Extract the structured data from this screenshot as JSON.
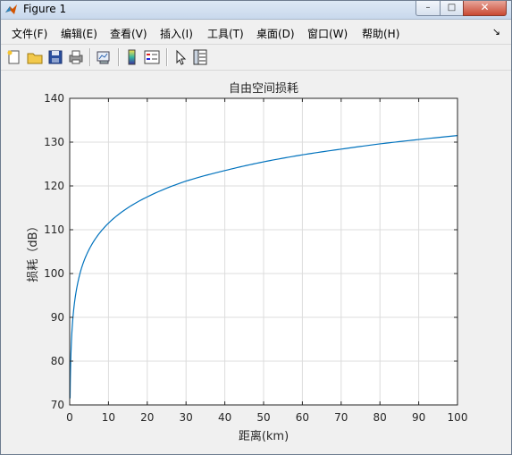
{
  "window": {
    "title": "Figure 1",
    "controls": {
      "minimize": "–",
      "maximize": "□",
      "close": "✕"
    }
  },
  "menu": {
    "items": [
      {
        "label": "文件(F)"
      },
      {
        "label": "编辑(E)"
      },
      {
        "label": "查看(V)"
      },
      {
        "label": "插入(I)"
      },
      {
        "label": "工具(T)"
      },
      {
        "label": "桌面(D)"
      },
      {
        "label": "窗口(W)"
      },
      {
        "label": "帮助(H)"
      }
    ],
    "overflow_icon": "↘"
  },
  "toolbar": {
    "buttons": [
      "new-figure-icon",
      "open-file-icon",
      "save-icon",
      "print-icon",
      "link-plot-icon",
      "colorbar-icon",
      "legend-icon",
      "pointer-icon",
      "property-inspector-icon"
    ]
  },
  "chart_data": {
    "type": "line",
    "title": "自由空间损耗",
    "xlabel": "距离(km)",
    "ylabel": "损耗（dB）",
    "xlim": [
      0,
      100
    ],
    "ylim": [
      70,
      140
    ],
    "xticks": [
      0,
      10,
      20,
      30,
      40,
      50,
      60,
      70,
      80,
      90,
      100
    ],
    "yticks": [
      70,
      80,
      90,
      100,
      110,
      120,
      130,
      140
    ],
    "grid": true,
    "series": [
      {
        "color": "#0072bd",
        "x": [
          0.1,
          0.5,
          1,
          2,
          3,
          5,
          10,
          20,
          30,
          40,
          50,
          60,
          70,
          80,
          90,
          100
        ],
        "y": [
          71.5,
          85.5,
          91.5,
          97.5,
          101.1,
          105.5,
          111.5,
          117.5,
          121.1,
          123.5,
          125.5,
          127.1,
          128.4,
          129.6,
          130.6,
          131.5
        ]
      }
    ]
  }
}
